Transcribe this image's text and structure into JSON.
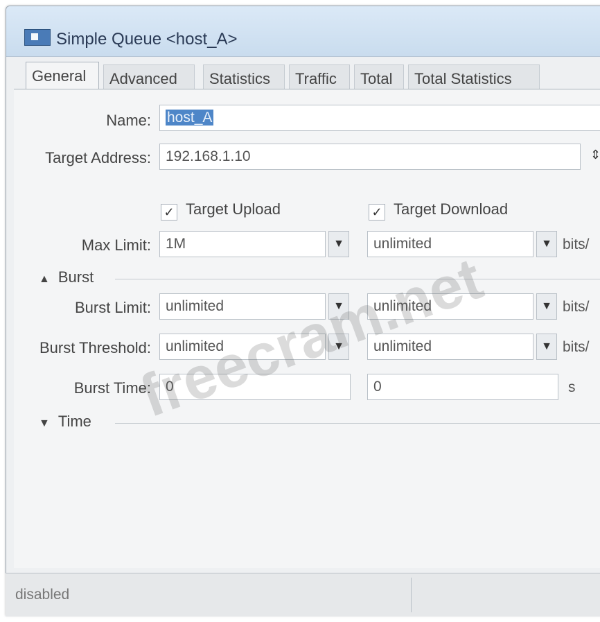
{
  "window": {
    "title": "Simple Queue <host_A>"
  },
  "tabs": [
    "General",
    "Advanced",
    "Statistics",
    "Traffic",
    "Total",
    "Total Statistics"
  ],
  "form": {
    "name_label": "Name:",
    "name_value": "host_A",
    "target_address_label": "Target Address:",
    "target_address_value": "192.168.1.10",
    "target_upload_label": "Target Upload",
    "target_download_label": "Target Download",
    "max_limit_label": "Max Limit:",
    "max_limit_upload": "1M",
    "max_limit_download": "unlimited",
    "unit_bits": "bits/",
    "burst_section": "Burst",
    "burst_limit_label": "Burst Limit:",
    "burst_limit_upload": "unlimited",
    "burst_limit_download": "unlimited",
    "burst_threshold_label": "Burst Threshold:",
    "burst_threshold_upload": "unlimited",
    "burst_threshold_download": "unlimited",
    "burst_time_label": "Burst Time:",
    "burst_time_upload": "0",
    "burst_time_download": "0",
    "unit_seconds": "s",
    "time_section": "Time"
  },
  "status": {
    "left": "disabled",
    "right": ""
  },
  "watermark": "freecram.net",
  "icons": {
    "dropdown": "dropdown-arrow-icon",
    "collapse": "triangle-up-icon",
    "expand": "triangle-down-icon",
    "check": "checkmark-icon"
  }
}
